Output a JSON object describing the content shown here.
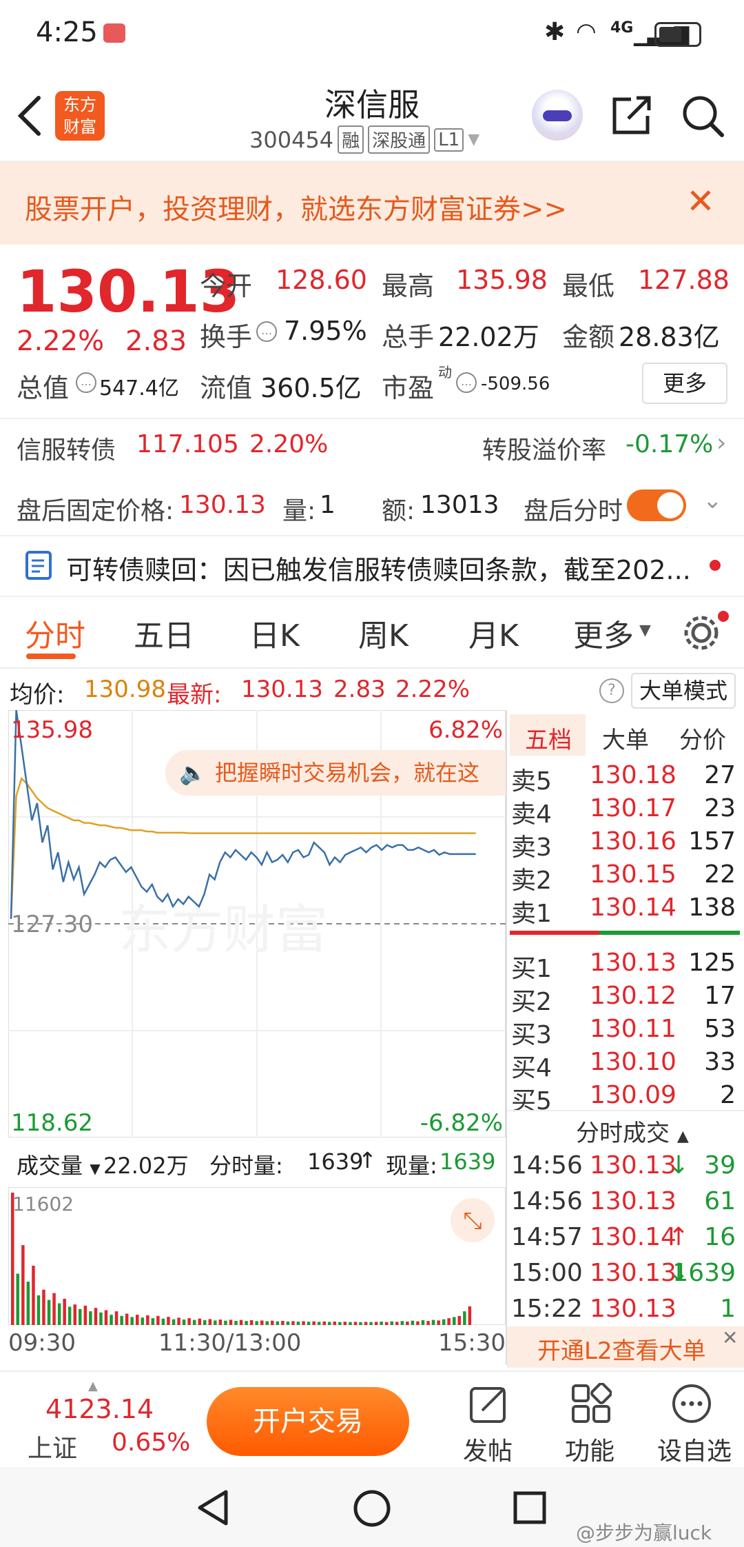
{
  "status": {
    "time": "4:25",
    "network": "4G"
  },
  "header": {
    "title": "深信服",
    "code": "300454",
    "badges": [
      "融",
      "深股通",
      "L1"
    ],
    "logo_lines": [
      "东方",
      "财富"
    ]
  },
  "banner": {
    "text": "股票开户，投资理财，就选东方财富证券>>"
  },
  "quote": {
    "price": "130.13",
    "pct": "2.22%",
    "chg": "2.83",
    "open_label": "今开",
    "open": "128.60",
    "high_label": "最高",
    "high": "135.98",
    "low_label": "最低",
    "low": "127.88",
    "turnover_label": "换手",
    "turnover": "7.95%",
    "volume_label": "总手",
    "volume": "22.02万",
    "amount_label": "金额",
    "amount": "28.83亿",
    "mcap_label": "总值",
    "mcap": "547.4亿",
    "float_label": "流值",
    "float": "360.5亿",
    "pe_label": "市盈",
    "pe_sup": "动",
    "pe": "-509.56",
    "more": "更多"
  },
  "bond": {
    "name": "信服转债",
    "price": "117.105",
    "pct": "2.20%",
    "premium_label": "转股溢价率",
    "premium": "-0.17%"
  },
  "afterhours": {
    "price_label": "盘后固定价格:",
    "price": "130.13",
    "qty_label": "量:",
    "qty": "1",
    "amt_label": "额:",
    "amt": "13013",
    "toggle_label": "盘后分时"
  },
  "notice": {
    "text": "可转债赎回：因已触发信服转债赎回条款，截至202..."
  },
  "tabs": [
    "分时",
    "五日",
    "日K",
    "周K",
    "月K",
    "更多"
  ],
  "summary": {
    "avg_label": "均价:",
    "avg": "130.98",
    "last_label": "最新:",
    "last": "130.13",
    "chg": "2.83",
    "pct": "2.22%",
    "mode": "大单模式"
  },
  "chart_labels": {
    "top": "135.98",
    "top_pct": "6.82%",
    "mid": "127.30",
    "bottom": "118.62",
    "bottom_pct": "-6.82%",
    "promo": "把握瞬时交易机会，就在这",
    "watermark": "东方财富"
  },
  "volume_bar": {
    "label": "成交量",
    "total": "22.02万",
    "fen_label": "分时量:",
    "fen": "1639",
    "now_label": "现量:",
    "now": "1639",
    "max": "11602"
  },
  "time_axis": [
    "09:30",
    "11:30/13:00",
    "15:30"
  ],
  "orderbook": {
    "tabs": [
      "五档",
      "大单",
      "分价"
    ],
    "sells": [
      {
        "l": "卖5",
        "p": "130.18",
        "v": "27"
      },
      {
        "l": "卖4",
        "p": "130.17",
        "v": "23"
      },
      {
        "l": "卖3",
        "p": "130.16",
        "v": "157"
      },
      {
        "l": "卖2",
        "p": "130.15",
        "v": "22"
      },
      {
        "l": "卖1",
        "p": "130.14",
        "v": "138"
      }
    ],
    "buys": [
      {
        "l": "买1",
        "p": "130.13",
        "v": "125"
      },
      {
        "l": "买2",
        "p": "130.12",
        "v": "17"
      },
      {
        "l": "买3",
        "p": "130.11",
        "v": "53"
      },
      {
        "l": "买4",
        "p": "130.10",
        "v": "33"
      },
      {
        "l": "买5",
        "p": "130.09",
        "v": "2"
      }
    ],
    "trades_title": "分时成交",
    "trades": [
      {
        "t": "14:56",
        "p": "130.13",
        "d": "↓",
        "v": "39"
      },
      {
        "t": "14:56",
        "p": "130.13",
        "d": "",
        "v": "61"
      },
      {
        "t": "14:57",
        "p": "130.14",
        "d": "↑",
        "v": "16"
      },
      {
        "t": "15:00",
        "p": "130.13",
        "d": "↓",
        "v": "1639"
      },
      {
        "t": "15:22",
        "p": "130.13",
        "d": "",
        "v": "1"
      }
    ],
    "l2": "开通L2查看大单"
  },
  "bottom": {
    "index_value": "4123.14",
    "index_name": "上证",
    "index_pct": "0.65%",
    "trade_btn": "开户交易",
    "post": "发帖",
    "func": "功能",
    "watch": "设自选"
  },
  "watermark_user": "@步步为赢luck",
  "colors": {
    "red": "#e1262c",
    "green": "#1b9a34",
    "orange": "#ff6a00",
    "price_line": "#3a6fa8",
    "avg_line": "#e0a020"
  },
  "chart_data": {
    "type": "line",
    "ylim": [
      118.62,
      135.98
    ],
    "series": [
      {
        "values": [
          127.5,
          135.98,
          134.5,
          133.0,
          131.5,
          132.2,
          130.6,
          131.3,
          129.5,
          130.2,
          129.0,
          129.8,
          129.1,
          129.6,
          128.5,
          128.9,
          129.3,
          129.8,
          129.6,
          129.9,
          130.0,
          129.7,
          129.4,
          129.6,
          129.2,
          128.8,
          128.6,
          128.9,
          128.4,
          128.2,
          128.5,
          128.0,
          128.3,
          128.1,
          128.4,
          128.2,
          128.0,
          128.5,
          129.3,
          129.1,
          129.8,
          130.2,
          130.0,
          130.3,
          130.1,
          129.9,
          130.2,
          130.0,
          129.7,
          130.2,
          129.8,
          129.9,
          130.1,
          129.8,
          130.2,
          130.3,
          130.0,
          130.1,
          130.6,
          130.4,
          130.2,
          129.7,
          130.0,
          129.8,
          130.1,
          130.2,
          130.3,
          130.4,
          130.2,
          130.4,
          130.5,
          130.3,
          130.5,
          130.4,
          130.5,
          130.5,
          130.3,
          130.3,
          130.4,
          130.3,
          130.2,
          130.3,
          130.1,
          130.2,
          130.13,
          130.13,
          130.13,
          130.13,
          130.13,
          130.13
        ]
      },
      {
        "values": [
          127.5,
          132.5,
          133.2,
          133.0,
          132.7,
          132.4,
          132.2,
          132.0,
          131.9,
          131.8,
          131.7,
          131.6,
          131.5,
          131.5,
          131.4,
          131.4,
          131.35,
          131.3,
          131.3,
          131.25,
          131.2,
          131.2,
          131.15,
          131.1,
          131.1,
          131.1,
          131.05,
          131.05,
          131.0,
          131.0,
          131.0,
          131.0,
          131.0,
          131.0,
          130.98,
          130.98,
          130.98,
          130.98,
          130.98,
          130.98,
          130.98,
          130.98,
          130.98,
          130.98,
          130.98,
          130.98,
          130.98,
          130.98,
          130.98,
          130.98,
          130.98,
          130.98,
          130.98,
          130.98,
          130.98,
          130.98,
          130.98,
          130.98,
          130.98,
          130.98,
          130.98,
          130.98,
          130.98,
          130.98,
          130.98,
          130.98,
          130.98,
          130.98,
          130.98,
          130.98,
          130.98,
          130.98,
          130.98,
          130.98,
          130.98,
          130.98,
          130.98,
          130.98,
          130.98,
          130.98,
          130.98,
          130.98,
          130.98,
          130.98,
          130.98,
          130.98,
          130.98,
          130.98,
          130.98,
          130.98
        ]
      }
    ],
    "volume": [
      11602,
      4500,
      7000,
      3800,
      5200,
      2600,
      3100,
      2200,
      2800,
      1900,
      2300,
      1600,
      1800,
      1400,
      1700,
      1200,
      1500,
      1100,
      1300,
      900,
      1200,
      800,
      1000,
      700,
      900,
      650,
      850,
      600,
      800,
      560,
      720,
      500,
      640,
      480,
      600,
      450,
      560,
      420,
      520,
      400,
      480,
      380,
      460,
      360,
      440,
      350,
      420,
      340,
      400,
      330,
      380,
      320,
      360,
      310,
      340,
      300,
      330,
      290,
      320,
      280,
      310,
      270,
      300,
      260,
      290,
      260,
      280,
      250,
      270,
      260,
      280,
      300,
      260,
      320,
      280,
      350,
      300,
      380,
      320,
      420,
      350,
      450,
      400,
      500,
      600,
      700,
      800,
      1200,
      1639,
      0
    ]
  }
}
